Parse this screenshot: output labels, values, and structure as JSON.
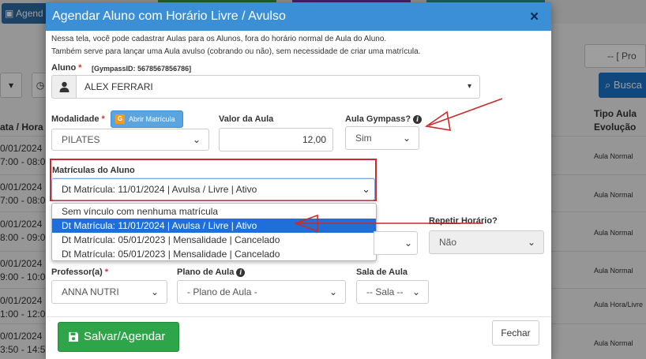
{
  "background": {
    "agenda_button": "Agend",
    "prefix_select": "-- [ Pro",
    "search_button": "Busca",
    "col_left_header": "ata / Hora",
    "col_right_header": "Tipo Aula Evolução",
    "rows": [
      {
        "date": "0/01/2024",
        "time": "7:00 - 08:00",
        "type": "Aula Normal"
      },
      {
        "date": "0/01/2024",
        "time": "7:00 - 08:00",
        "type": "Aula Normal"
      },
      {
        "date": "0/01/2024",
        "time": "8:00 - 09:00",
        "type": "Aula Normal"
      },
      {
        "date": "0/01/2024",
        "time": "9:00 - 10:00",
        "type": "Aula Normal"
      },
      {
        "date": "0/01/2024",
        "time": "1:00 - 12:00",
        "type": "Aula Hora/Livre"
      },
      {
        "date": "0/01/2024",
        "time": "3:50 - 14:50",
        "type": "Aula Normal"
      }
    ]
  },
  "modal": {
    "title": "Agendar Aluno com Horário Livre / Avulso",
    "close_symbol": "×",
    "desc_line1": "Nessa tela, você pode cadastrar Aulas para os Alunos, fora do horário normal de Aula do Aluno.",
    "desc_line2": "Também serve para lançar uma Aula avulso (cobrando ou não), sem necessidade de criar uma matrícula.",
    "aluno": {
      "label": "Aluno",
      "required": "*",
      "gympass_id": "[GympassID: 5678567856786]",
      "value": "ALEX FERRARI"
    },
    "modalidade": {
      "label": "Modalidade",
      "required": "*",
      "button_icon": "G",
      "button_label": "Abrir Matrícula",
      "value": "PILATES"
    },
    "valor": {
      "label": "Valor da Aula",
      "value": "12,00"
    },
    "gympass": {
      "label": "Aula Gympass?",
      "value": "Sim"
    },
    "matriculas": {
      "label": "Matrículas do Aluno",
      "selected": "Dt Matrícula: 11/01/2024 | Avulsa / Livre | Ativo",
      "options": [
        "Sem vínculo com nenhuma matrícula",
        "Dt Matrícula: 11/01/2024 | Avulsa / Livre | Ativo",
        "Dt Matrícula: 05/01/2023 | Mensalidade | Cancelado",
        "Dt Matrícula: 05/01/2023 | Mensalidade | Cancelado"
      ],
      "highlighted_index": 1
    },
    "repetir": {
      "label": "Repetir Horário?",
      "value": "Não"
    },
    "professor": {
      "label": "Professor(a)",
      "required": "*",
      "value": "ANNA NUTRI"
    },
    "plano": {
      "label": "Plano de Aula",
      "value": "- Plano de Aula -"
    },
    "sala": {
      "label": "Sala de Aula",
      "value": "-- Sala --"
    },
    "save_button": "Salvar/Agendar",
    "close_button": "Fechar"
  },
  "colors": {
    "header": "#3a8fd6",
    "save": "#2fa54a",
    "highlight": "#1e6fd9",
    "annotation": "#cc2a2a"
  }
}
